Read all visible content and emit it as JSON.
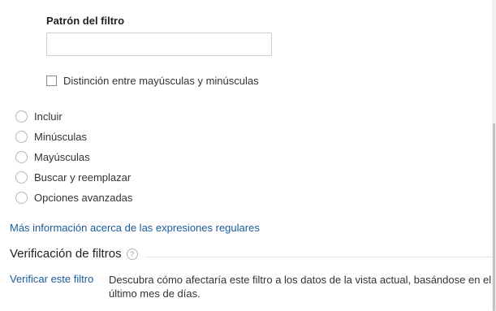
{
  "pattern": {
    "label": "Patrón del filtro",
    "value": "",
    "placeholder": ""
  },
  "case_sensitive": {
    "label": "Distinción entre mayúsculas y minúsculas",
    "checked": false
  },
  "filter_options": [
    {
      "label": "Incluir",
      "selected": false
    },
    {
      "label": "Minúsculas",
      "selected": false
    },
    {
      "label": "Mayúsculas",
      "selected": false
    },
    {
      "label": "Buscar y reemplazar",
      "selected": false
    },
    {
      "label": "Opciones avanzadas",
      "selected": false
    }
  ],
  "regex_link": "Más información acerca de las expresiones regulares",
  "verification": {
    "title": "Verificación de filtros",
    "help_icon": "question-mark-icon",
    "verify_link": "Verificar este filtro",
    "description": "Descubra cómo afectaría este filtro a los datos de la vista actual, basándose en el último mes de días."
  },
  "colors": {
    "link": "#1a5b9a",
    "text": "#333333",
    "border": "#cfcfcf"
  }
}
